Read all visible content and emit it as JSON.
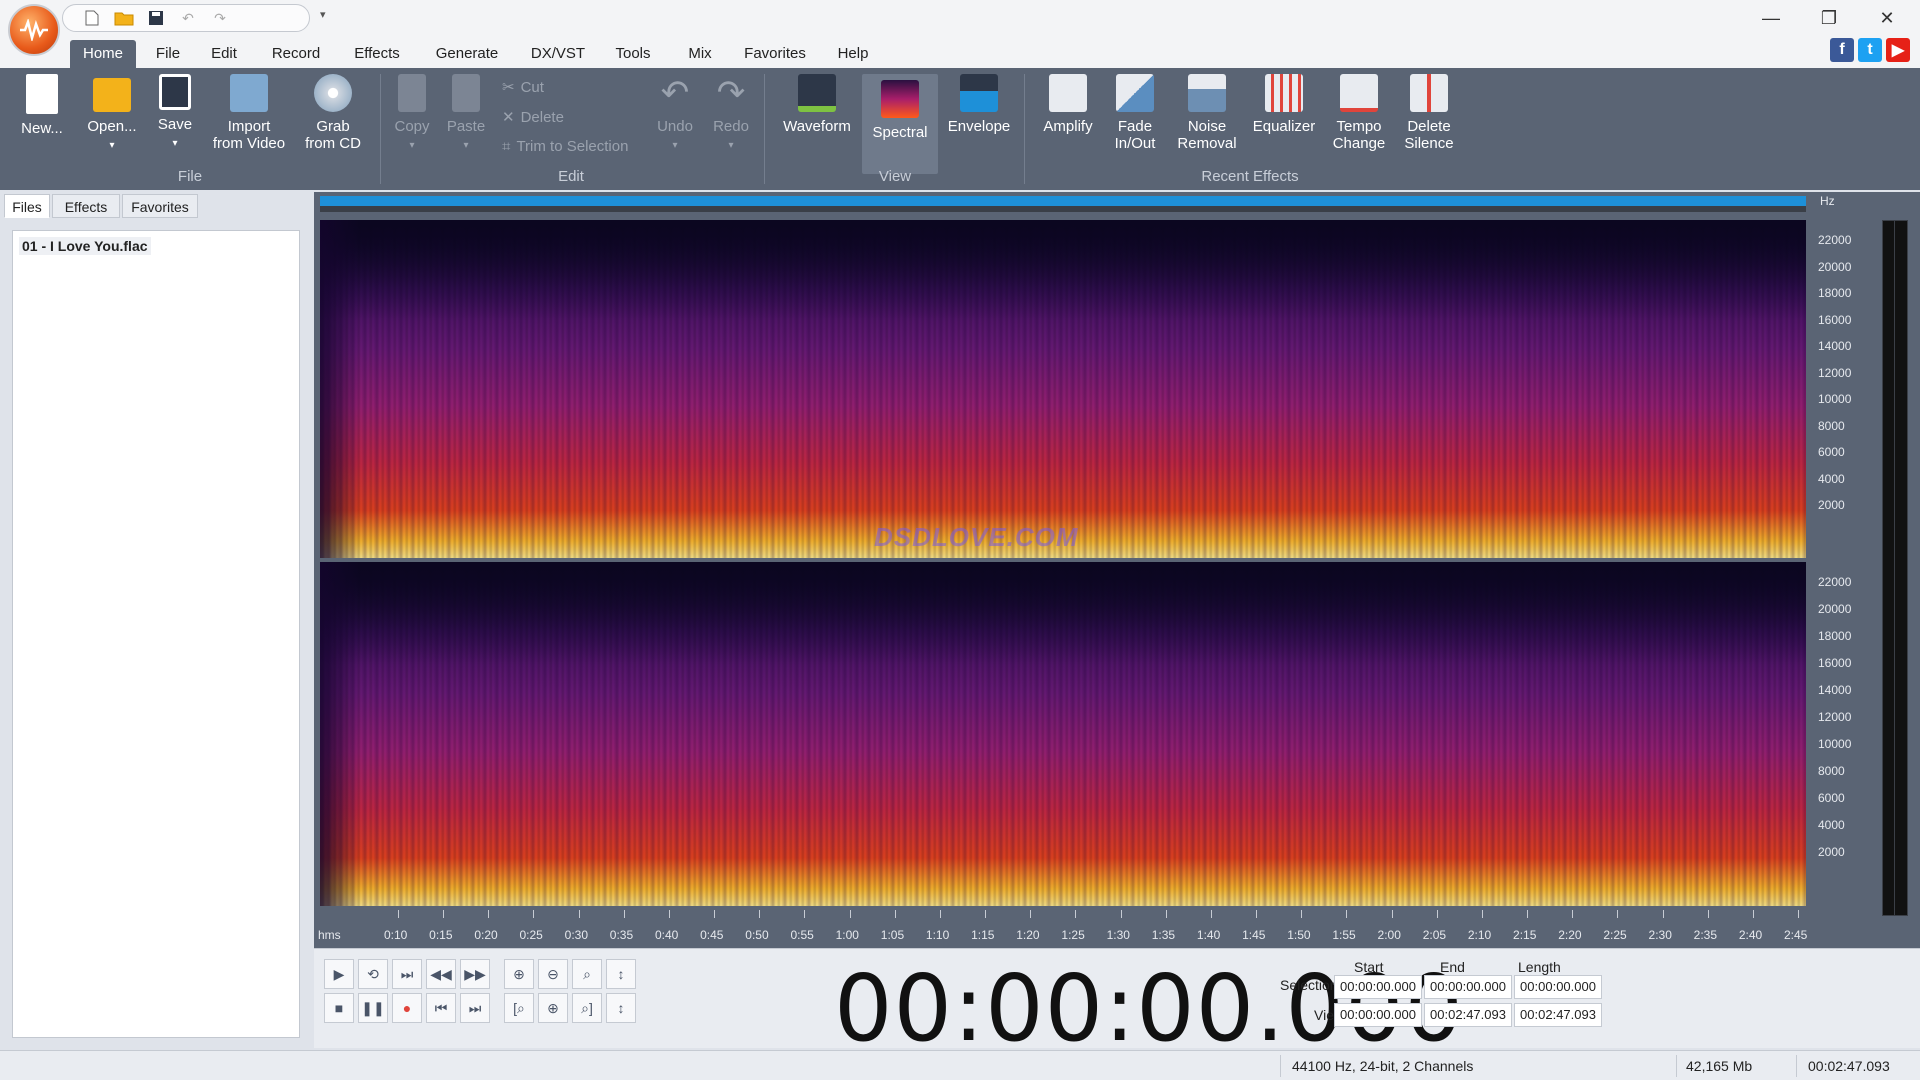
{
  "qat": {
    "icons": [
      "new-icon",
      "folder-icon",
      "save-icon",
      "undo-icon",
      "redo-icon",
      "customize-icon"
    ]
  },
  "menu_tabs": [
    "Home",
    "File",
    "Edit",
    "Record",
    "Effects",
    "Generate",
    "DX/VST",
    "Tools",
    "Mix",
    "Favorites",
    "Help"
  ],
  "active_tab": "Home",
  "ribbon": {
    "file": {
      "new": "New...",
      "open": "Open...",
      "save": "Save",
      "import_line1": "Import",
      "import_line2": "from Video",
      "grab_line1": "Grab",
      "grab_line2": "from CD",
      "group": "File"
    },
    "edit": {
      "copy": "Copy",
      "paste": "Paste",
      "cut": "Cut",
      "delete": "Delete",
      "trim": "Trim to Selection",
      "undo": "Undo",
      "redo": "Redo",
      "group": "Edit"
    },
    "view": {
      "waveform": "Waveform",
      "spectral": "Spectral",
      "envelope": "Envelope",
      "group": "View"
    },
    "effects": {
      "amplify": "Amplify",
      "fade_line1": "Fade",
      "fade_line2": "In/Out",
      "noise_line1": "Noise",
      "noise_line2": "Removal",
      "equalizer": "Equalizer",
      "tempo_line1": "Tempo",
      "tempo_line2": "Change",
      "silence_line1": "Delete",
      "silence_line2": "Silence",
      "group": "Recent Effects"
    }
  },
  "colors": {
    "ribbon_bg": "#5a6474",
    "overview_bar": "#1e90d8",
    "facebook": "#3b5998",
    "twitter": "#1da1f2",
    "youtube": "#e62117"
  },
  "panel_tabs": [
    "Files",
    "Effects",
    "Favorites"
  ],
  "files": [
    "01 - I Love You.flac"
  ],
  "watermark": "DSDLOVE.COM",
  "hz_unit": "Hz",
  "hz_labels": [
    "22000",
    "20000",
    "18000",
    "16000",
    "14000",
    "12000",
    "10000",
    "8000",
    "6000",
    "4000",
    "2000"
  ],
  "time_unit": "hms",
  "time_labels": [
    "0:10",
    "0:15",
    "0:20",
    "0:25",
    "0:30",
    "0:35",
    "0:40",
    "0:45",
    "0:50",
    "0:55",
    "1:00",
    "1:05",
    "1:10",
    "1:15",
    "1:20",
    "1:25",
    "1:30",
    "1:35",
    "1:40",
    "1:45",
    "1:50",
    "1:55",
    "2:00",
    "2:05",
    "2:10",
    "2:15",
    "2:20",
    "2:25",
    "2:30",
    "2:35",
    "2:40",
    "2:45"
  ],
  "big_time": "00:00:00.000",
  "selection": {
    "headers": [
      "Start",
      "End",
      "Length"
    ],
    "selection_label": "Selection",
    "view_label": "View",
    "selection_values": [
      "00:00:00.000",
      "00:00:00.000",
      "00:00:00.000"
    ],
    "view_values": [
      "00:00:00.000",
      "00:02:47.093",
      "00:02:47.093"
    ]
  },
  "status": {
    "format": "44100 Hz, 24-bit, 2 Channels",
    "size": "42,165 Mb",
    "duration": "00:02:47.093"
  }
}
